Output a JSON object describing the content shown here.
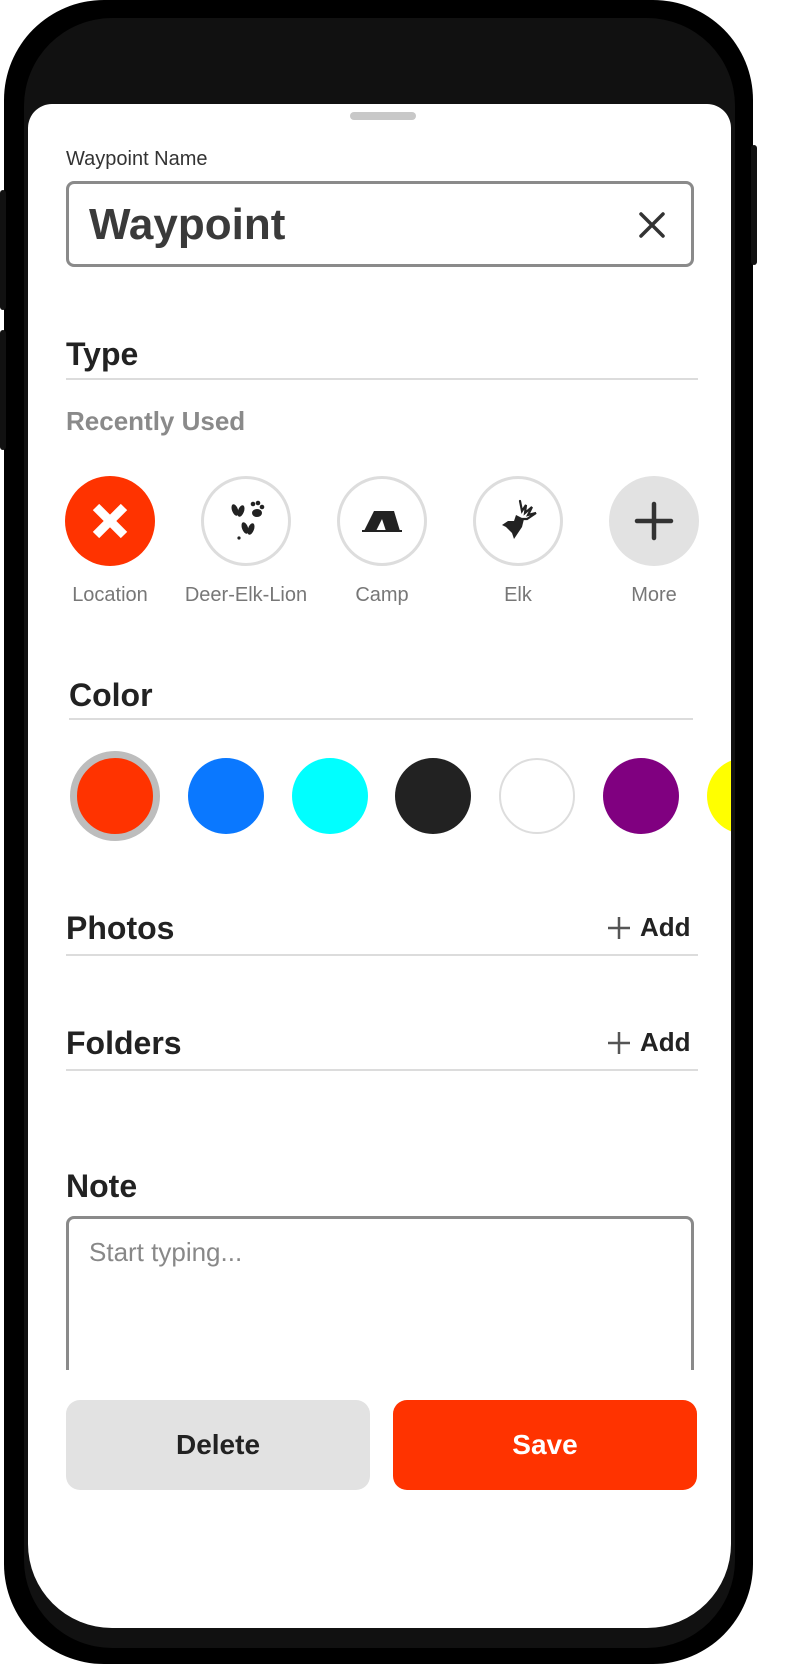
{
  "waypoint_name": {
    "label": "Waypoint Name",
    "value": "Waypoint"
  },
  "type": {
    "title": "Type",
    "recent_label": "Recently Used",
    "items": [
      {
        "label": "Location",
        "icon": "close-x-icon",
        "selected": true
      },
      {
        "label": "Deer-Elk-Lion",
        "icon": "animal-tracks-icon"
      },
      {
        "label": "Camp",
        "icon": "tent-icon"
      },
      {
        "label": "Elk",
        "icon": "elk-head-icon"
      },
      {
        "label": "More",
        "icon": "plus-icon"
      }
    ]
  },
  "color": {
    "title": "Color",
    "swatches": [
      "#ff3300",
      "#0a78ff",
      "#00ffff",
      "#222222",
      "#ffffff",
      "#800080",
      "#ffff00"
    ],
    "selected": "#ff3300"
  },
  "photos": {
    "title": "Photos",
    "add_label": "Add"
  },
  "folders": {
    "title": "Folders",
    "add_label": "Add"
  },
  "note": {
    "title": "Note",
    "placeholder": "Start typing..."
  },
  "actions": {
    "delete_label": "Delete",
    "save_label": "Save"
  },
  "colors": {
    "accent": "#ff3300",
    "neutral_button": "#e2e2e2"
  }
}
